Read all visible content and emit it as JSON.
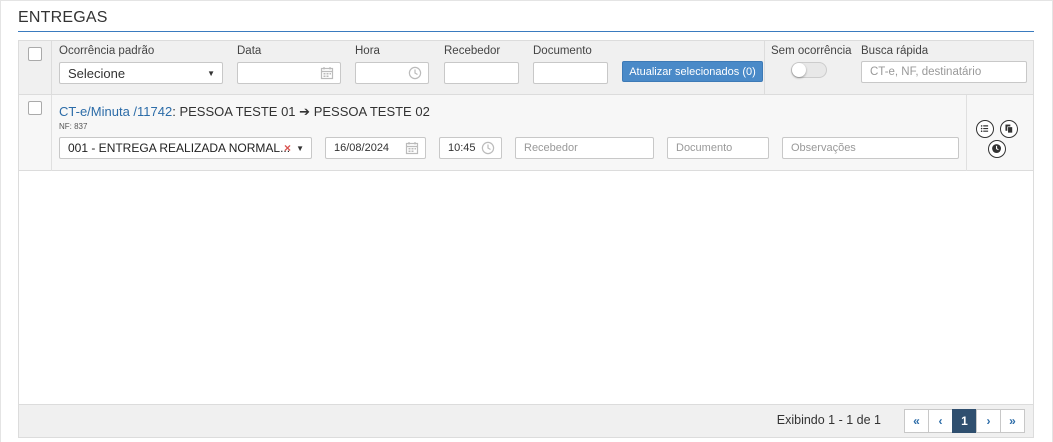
{
  "page": {
    "title": "ENTREGAS"
  },
  "filters": {
    "ocorrencia_label": "Ocorrência padrão",
    "ocorrencia_value": "Selecione",
    "data_label": "Data",
    "hora_label": "Hora",
    "recebedor_label": "Recebedor",
    "documento_label": "Documento",
    "update_button": "Atualizar selecionados (0)",
    "sem_ocorrencia_label": "Sem ocorrência",
    "sem_ocorrencia_on": false,
    "busca_label": "Busca rápida",
    "busca_placeholder": "CT-e, NF, destinatário"
  },
  "rows": [
    {
      "ct_link": "CT-e/Minuta /11742",
      "ct_text": ": PESSOA TESTE 01",
      "arrow": "➔",
      "dest": "PESSOA TESTE 02",
      "nf": "NF: 837",
      "ocorrencia": "001 - ENTREGA REALIZADA NORMAL...",
      "clear_glyph": "×",
      "date": "16/08/2024",
      "time": "10:45",
      "recebedor_placeholder": "Recebedor",
      "documento_placeholder": "Documento",
      "obs_placeholder": "Observações"
    }
  ],
  "footer": {
    "showing": "Exibindo 1 - 1 de 1",
    "first": "«",
    "prev": "‹",
    "page": "1",
    "next": "›",
    "last": "»"
  },
  "colors": {
    "accent": "#4a8ac8",
    "link": "#2c6ca8",
    "active_page": "#2f4f6f"
  }
}
